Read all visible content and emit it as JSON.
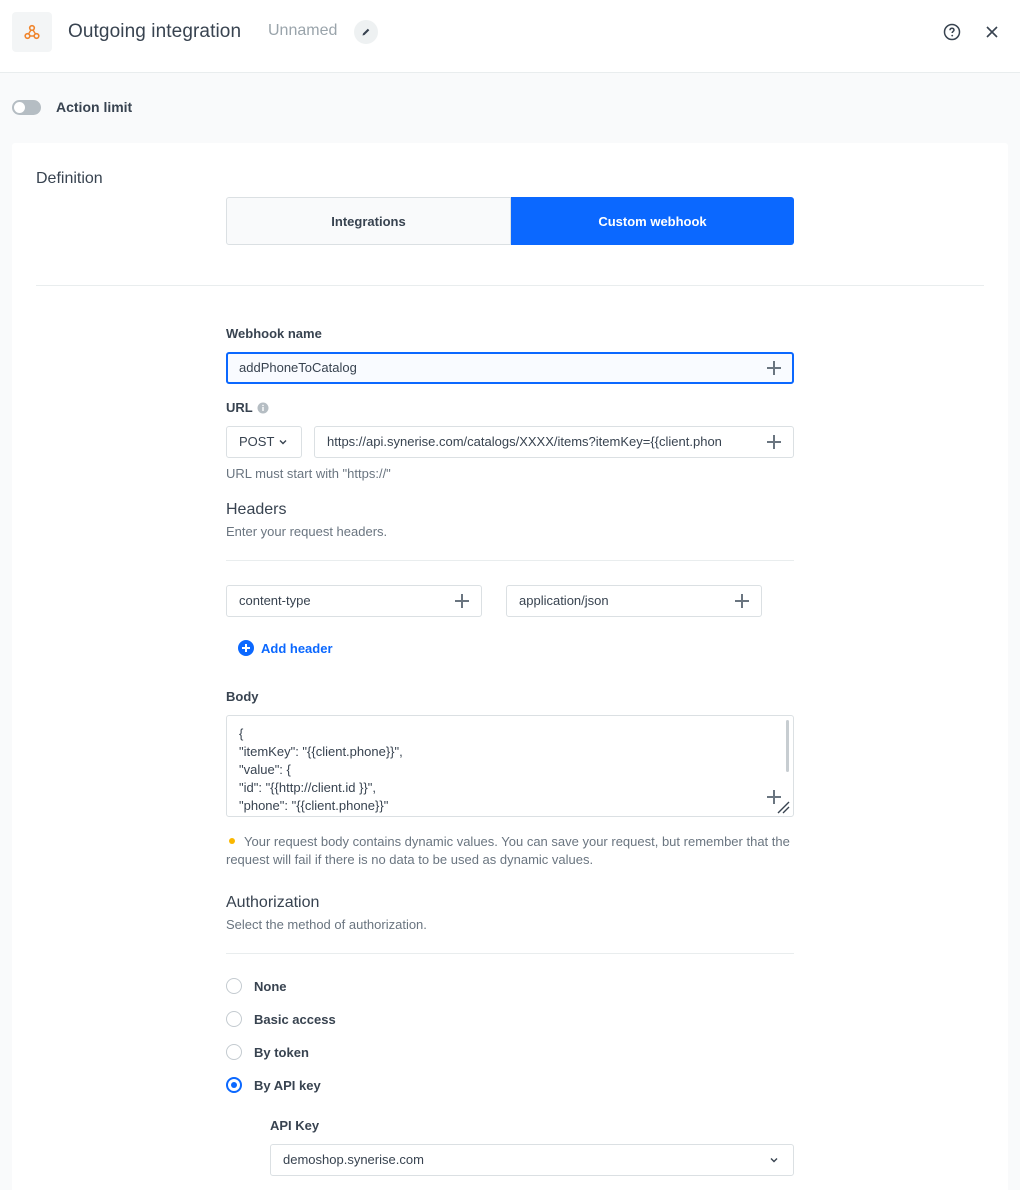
{
  "header": {
    "title": "Outgoing integration",
    "subtitle": "Unnamed",
    "icons": {
      "app": "webhook-icon",
      "edit": "pencil-icon",
      "help": "help-circle-icon",
      "close": "close-icon"
    }
  },
  "action_limit": {
    "label": "Action limit",
    "enabled": false
  },
  "definition": {
    "title": "Definition",
    "tabs": [
      {
        "label": "Integrations",
        "active": false
      },
      {
        "label": "Custom webhook",
        "active": true
      }
    ]
  },
  "webhook_name": {
    "label": "Webhook name",
    "value": "addPhoneToCatalog"
  },
  "url": {
    "label": "URL",
    "method": "POST",
    "value": "https://api.synerise.com/catalogs/XXXX/items?itemKey={{client.phon",
    "hint": "URL must start with \"https://\""
  },
  "headers": {
    "title": "Headers",
    "description": "Enter your request headers.",
    "key": "content-type",
    "value": "application/json",
    "add_label": "Add header"
  },
  "body": {
    "label": "Body",
    "lines": [
      "{",
      "\"itemKey\": \"{{client.phone}}\",",
      "\"value\": {",
      "\"id\": \"{{http://client.id }}\",",
      "\"phone\": \"{{client.phone}}\""
    ],
    "warning": "Your request body contains dynamic values. You can save your request, but remember that the request will fail if there is no data to be used as dynamic values."
  },
  "authorization": {
    "title": "Authorization",
    "description": "Select the method of authorization.",
    "options": [
      {
        "label": "None",
        "checked": false
      },
      {
        "label": "Basic access",
        "checked": false
      },
      {
        "label": "By token",
        "checked": false
      },
      {
        "label": "By API key",
        "checked": true
      }
    ],
    "api_key_label": "API Key",
    "api_key_value": "demoshop.synerise.com"
  },
  "colors": {
    "primary": "#0b68ff",
    "warning": "#fab700",
    "brand_icon": "#f0852d"
  }
}
